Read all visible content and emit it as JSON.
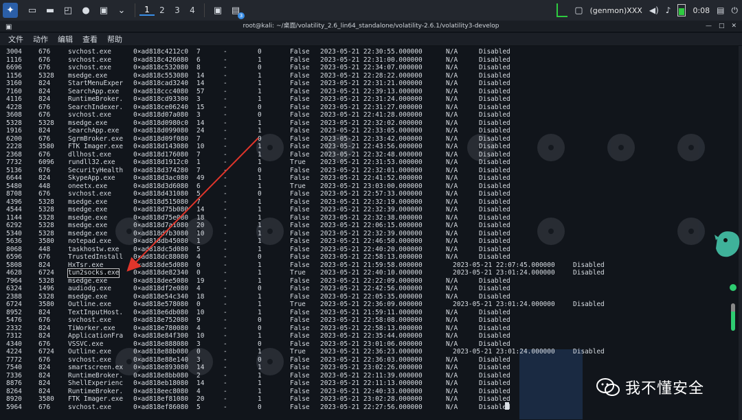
{
  "taskbar": {
    "workspaces": [
      "1",
      "2",
      "3",
      "4"
    ],
    "active_workspace": "1",
    "genmon": "(genmon)XXX",
    "clock": "0:08",
    "badge_count": "3"
  },
  "window": {
    "title": "root@kali: ~/桌面/volatility_2.6_lin64_standalone/volatility-2.6.1/volatility3-develop"
  },
  "menu": [
    "文件",
    "动作",
    "编辑",
    "查看",
    "帮助"
  ],
  "rows": [
    {
      "pid": "3004",
      "ppid": "676",
      "name": "svchost.exe",
      "offset": "0×ad818c4212c0",
      "threads": "7",
      "handles": "-",
      "session": "0",
      "wow64": "False",
      "create": "2023-05-21 22:30:55.000000",
      "exit": "N/A",
      "output": "Disabled"
    },
    {
      "pid": "1116",
      "ppid": "676",
      "name": "svchost.exe",
      "offset": "0×ad818c426080",
      "threads": "6",
      "handles": "-",
      "session": "1",
      "wow64": "False",
      "create": "2023-05-21 22:31:00.000000",
      "exit": "N/A",
      "output": "Disabled"
    },
    {
      "pid": "6696",
      "ppid": "676",
      "name": "svchost.exe",
      "offset": "0×ad818c532080",
      "threads": "8",
      "handles": "-",
      "session": "0",
      "wow64": "False",
      "create": "2023-05-21 22:34:07.000000",
      "exit": "N/A",
      "output": "Disabled"
    },
    {
      "pid": "1156",
      "ppid": "5328",
      "name": "msedge.exe",
      "offset": "0×ad818c553080",
      "threads": "14",
      "handles": "-",
      "session": "1",
      "wow64": "False",
      "create": "2023-05-21 22:28:22.000000",
      "exit": "N/A",
      "output": "Disabled",
      "highlight": true
    },
    {
      "pid": "3160",
      "ppid": "824",
      "name": "StartMenuExper",
      "offset": "0×ad818cad3240",
      "threads": "14",
      "handles": "-",
      "session": "1",
      "wow64": "False",
      "create": "2023-05-21 22:31:21.000000",
      "exit": "N/A",
      "output": "Disabled"
    },
    {
      "pid": "7160",
      "ppid": "824",
      "name": "SearchApp.exe",
      "offset": "0×ad818ccc4080",
      "threads": "57",
      "handles": "-",
      "session": "1",
      "wow64": "False",
      "create": "2023-05-21 22:39:13.000000",
      "exit": "N/A",
      "output": "Disabled"
    },
    {
      "pid": "4116",
      "ppid": "824",
      "name": "RuntimeBroker.",
      "offset": "0×ad818cd93300",
      "threads": "3",
      "handles": "-",
      "session": "1",
      "wow64": "False",
      "create": "2023-05-21 22:31:24.000000",
      "exit": "N/A",
      "output": "Disabled"
    },
    {
      "pid": "4228",
      "ppid": "676",
      "name": "SearchIndexer.",
      "offset": "0×ad818ce06240",
      "threads": "15",
      "handles": "-",
      "session": "0",
      "wow64": "False",
      "create": "2023-05-21 22:31:27.000000",
      "exit": "N/A",
      "output": "Disabled"
    },
    {
      "pid": "3608",
      "ppid": "676",
      "name": "svchost.exe",
      "offset": "0×ad818d07a080",
      "threads": "3",
      "handles": "-",
      "session": "0",
      "wow64": "False",
      "create": "2023-05-21 22:41:28.000000",
      "exit": "N/A",
      "output": "Disabled"
    },
    {
      "pid": "5328",
      "ppid": "5328",
      "name": "msedge.exe",
      "offset": "0×ad818d0980c0",
      "threads": "14",
      "handles": "-",
      "session": "1",
      "wow64": "False",
      "create": "2023-05-21 22:32:02.000000",
      "exit": "N/A",
      "output": "Disabled"
    },
    {
      "pid": "1916",
      "ppid": "824",
      "name": "SearchApp.exe",
      "offset": "0×ad818d099080",
      "threads": "24",
      "handles": "-",
      "session": "1",
      "wow64": "False",
      "create": "2023-05-21 22:33:05.000000",
      "exit": "N/A",
      "output": "Disabled"
    },
    {
      "pid": "6200",
      "ppid": "676",
      "name": "SgrmBroker.exe",
      "offset": "0×ad818d09f080",
      "threads": "7",
      "handles": "-",
      "session": "0",
      "wow64": "False",
      "create": "2023-05-21 22:33:42.000000",
      "exit": "N/A",
      "output": "Disabled"
    },
    {
      "pid": "2228",
      "ppid": "3580",
      "name": "FTK Imager.exe",
      "offset": "0×ad818d143080",
      "threads": "10",
      "handles": "-",
      "session": "1",
      "wow64": "False",
      "create": "2023-05-21 22:43:56.000000",
      "exit": "N/A",
      "output": "Disabled"
    },
    {
      "pid": "2368",
      "ppid": "676",
      "name": "dllhost.exe",
      "offset": "0×ad818d176080",
      "threads": "7",
      "handles": "-",
      "session": "1",
      "wow64": "False",
      "create": "2023-05-21 22:32:48.000000",
      "exit": "N/A",
      "output": "Disabled"
    },
    {
      "pid": "7732",
      "ppid": "6096",
      "name": "rundll32.exe",
      "offset": "0×ad818d1912c0",
      "threads": "1",
      "handles": "-",
      "session": "1",
      "wow64": "True",
      "create": "2023-05-21 22:31:53.000000",
      "exit": "N/A",
      "output": "Disabled"
    },
    {
      "pid": "5136",
      "ppid": "676",
      "name": "SecurityHealth",
      "offset": "0×ad818d374280",
      "threads": "7",
      "handles": "-",
      "session": "0",
      "wow64": "False",
      "create": "2023-05-21 22:32:01.000000",
      "exit": "N/A",
      "output": "Disabled"
    },
    {
      "pid": "6644",
      "ppid": "824",
      "name": "SkypeApp.exe",
      "offset": "0×ad818d3ac080",
      "threads": "49",
      "handles": "-",
      "session": "1",
      "wow64": "False",
      "create": "2023-05-21 22:41:52.000000",
      "exit": "N/A",
      "output": "Disabled"
    },
    {
      "pid": "5480",
      "ppid": "448",
      "name": "oneetx.exe",
      "offset": "0×ad818d3d6080",
      "threads": "6",
      "handles": "-",
      "session": "1",
      "wow64": "True",
      "create": "2023-05-21 23:03:00.000000",
      "exit": "N/A",
      "output": "Disabled"
    },
    {
      "pid": "8708",
      "ppid": "676",
      "name": "svchost.exe",
      "offset": "0×ad818d431080",
      "threads": "5",
      "handles": "-",
      "session": "0",
      "wow64": "False",
      "create": "2023-05-21 22:57:33.000000",
      "exit": "N/A",
      "output": "Disabled"
    },
    {
      "pid": "4396",
      "ppid": "5328",
      "name": "msedge.exe",
      "offset": "0×ad818d515080",
      "threads": "7",
      "handles": "-",
      "session": "1",
      "wow64": "False",
      "create": "2023-05-21 22:32:19.000000",
      "exit": "N/A",
      "output": "Disabled"
    },
    {
      "pid": "4544",
      "ppid": "5328",
      "name": "msedge.exe",
      "offset": "0×ad818d75b080",
      "threads": "14",
      "handles": "-",
      "session": "1",
      "wow64": "False",
      "create": "2023-05-21 22:32:39.000000",
      "exit": "N/A",
      "output": "Disabled"
    },
    {
      "pid": "1144",
      "ppid": "5328",
      "name": "msedge.exe",
      "offset": "0×ad818d75e080",
      "threads": "18",
      "handles": "-",
      "session": "1",
      "wow64": "False",
      "create": "2023-05-21 22:32:38.000000",
      "exit": "N/A",
      "output": "Disabled"
    },
    {
      "pid": "6292",
      "ppid": "5328",
      "name": "msedge.exe",
      "offset": "0×ad818d7a1080",
      "threads": "20",
      "handles": "-",
      "session": "1",
      "wow64": "False",
      "create": "2023-05-21 22:06:15.000000",
      "exit": "N/A",
      "output": "Disabled"
    },
    {
      "pid": "5340",
      "ppid": "5328",
      "name": "msedge.exe",
      "offset": "0×ad818d7b3080",
      "threads": "10",
      "handles": "-",
      "session": "1",
      "wow64": "False",
      "create": "2023-05-21 22:32:39.000000",
      "exit": "N/A",
      "output": "Disabled"
    },
    {
      "pid": "5636",
      "ppid": "3580",
      "name": "notepad.exe",
      "offset": "0×ad818db45080",
      "threads": "1",
      "handles": "-",
      "session": "1",
      "wow64": "False",
      "create": "2023-05-21 22:46:50.000000",
      "exit": "N/A",
      "output": "Disabled"
    },
    {
      "pid": "8068",
      "ppid": "448",
      "name": "taskhostw.exe",
      "offset": "0×ad818dc5d080",
      "threads": "5",
      "handles": "-",
      "session": "1",
      "wow64": "False",
      "create": "2023-05-21 22:40:20.000000",
      "exit": "N/A",
      "output": "Disabled"
    },
    {
      "pid": "6596",
      "ppid": "676",
      "name": "TrustedInstall",
      "offset": "0×ad818dc88080",
      "threads": "4",
      "handles": "-",
      "session": "0",
      "wow64": "False",
      "create": "2023-05-21 22:58:13.000000",
      "exit": "N/A",
      "output": "Disabled"
    },
    {
      "pid": "5808",
      "ppid": "824",
      "name": "HxTsr.exe",
      "offset": "0×ad818de5d080",
      "threads": "0",
      "handles": "-",
      "session": "1",
      "wow64": "False",
      "create": "2023-05-21 21:59:58.000000",
      "exit": "2023-05-21 22:07:45.000000",
      "output": "Disabled"
    },
    {
      "pid": "4628",
      "ppid": "6724",
      "name": "tun2socks.exe",
      "offset": "0×ad818de82340",
      "threads": "0",
      "handles": "-",
      "session": "1",
      "wow64": "True",
      "create": "2023-05-21 22:40:10.000000",
      "exit": "2023-05-21 23:01:24.000000",
      "output": "Disabled",
      "boxed": true
    },
    {
      "pid": "7964",
      "ppid": "5328",
      "name": "msedge.exe",
      "offset": "0×ad818dee5080",
      "threads": "19",
      "handles": "-",
      "session": "1",
      "wow64": "False",
      "create": "2023-05-21 22:22:09.000000",
      "exit": "N/A",
      "output": "Disabled"
    },
    {
      "pid": "6324",
      "ppid": "1496",
      "name": "audiodg.exe",
      "offset": "0×ad818df2e080",
      "threads": "4",
      "handles": "-",
      "session": "0",
      "wow64": "False",
      "create": "2023-05-21 22:42:56.000000",
      "exit": "N/A",
      "output": "Disabled"
    },
    {
      "pid": "2388",
      "ppid": "5328",
      "name": "msedge.exe",
      "offset": "0×ad818e54c340",
      "threads": "18",
      "handles": "-",
      "session": "1",
      "wow64": "False",
      "create": "2023-05-21 22:05:35.000000",
      "exit": "N/A",
      "output": "Disabled"
    },
    {
      "pid": "6724",
      "ppid": "3580",
      "name": "Outline.exe",
      "offset": "0×ad818e578080",
      "threads": "0",
      "handles": "-",
      "session": "1",
      "wow64": "True",
      "create": "2023-05-21 22:36:09.000000",
      "exit": "2023-05-21 23:01:24.000000",
      "output": "Disabled"
    },
    {
      "pid": "8952",
      "ppid": "824",
      "name": "TextInputHost.",
      "offset": "0×ad818e6db080",
      "threads": "10",
      "handles": "-",
      "session": "1",
      "wow64": "False",
      "create": "2023-05-21 21:59:11.000000",
      "exit": "N/A",
      "output": "Disabled"
    },
    {
      "pid": "5476",
      "ppid": "676",
      "name": "svchost.exe",
      "offset": "0×ad818e752080",
      "threads": "9",
      "handles": "-",
      "session": "0",
      "wow64": "False",
      "create": "2023-05-21 22:58:08.000000",
      "exit": "N/A",
      "output": "Disabled"
    },
    {
      "pid": "2332",
      "ppid": "824",
      "name": "TiWorker.exe",
      "offset": "0×ad818e780080",
      "threads": "4",
      "handles": "-",
      "session": "0",
      "wow64": "False",
      "create": "2023-05-21 22:58:13.000000",
      "exit": "N/A",
      "output": "Disabled"
    },
    {
      "pid": "7312",
      "ppid": "824",
      "name": "ApplicationFra",
      "offset": "0×ad818e84f300",
      "threads": "10",
      "handles": "-",
      "session": "1",
      "wow64": "False",
      "create": "2023-05-21 22:35:44.000000",
      "exit": "N/A",
      "output": "Disabled"
    },
    {
      "pid": "4340",
      "ppid": "676",
      "name": "VSSVC.exe",
      "offset": "0×ad818e888080",
      "threads": "3",
      "handles": "-",
      "session": "0",
      "wow64": "False",
      "create": "2023-05-21 23:01:06.000000",
      "exit": "N/A",
      "output": "Disabled"
    },
    {
      "pid": "4224",
      "ppid": "6724",
      "name": "Outline.exe",
      "offset": "0×ad818e88b080",
      "threads": "0",
      "handles": "-",
      "session": "1",
      "wow64": "True",
      "create": "2023-05-21 22:36:23.000000",
      "exit": "2023-05-21 23:01:24.000000",
      "output": "Disabled"
    },
    {
      "pid": "7772",
      "ppid": "676",
      "name": "svchost.exe",
      "offset": "0×ad818e88e140",
      "threads": "3",
      "handles": "-",
      "session": "0",
      "wow64": "False",
      "create": "2023-05-21 22:36:03.000000",
      "exit": "N/A",
      "output": "Disabled"
    },
    {
      "pid": "7540",
      "ppid": "824",
      "name": "smartscreen.ex",
      "offset": "0×ad818e893080",
      "threads": "14",
      "handles": "-",
      "session": "1",
      "wow64": "False",
      "create": "2023-05-21 23:02:26.000000",
      "exit": "N/A",
      "output": "Disabled"
    },
    {
      "pid": "7336",
      "ppid": "824",
      "name": "RuntimeBroker.",
      "offset": "0×ad818e8bb080",
      "threads": "2",
      "handles": "-",
      "session": "1",
      "wow64": "False",
      "create": "2023-05-21 22:11:39.000000",
      "exit": "N/A",
      "output": "Disabled"
    },
    {
      "pid": "8876",
      "ppid": "824",
      "name": "ShellExperienc",
      "offset": "0×ad818eb18080",
      "threads": "14",
      "handles": "-",
      "session": "1",
      "wow64": "False",
      "create": "2023-05-21 22:11:13.000000",
      "exit": "N/A",
      "output": "Disabled"
    },
    {
      "pid": "8264",
      "ppid": "824",
      "name": "RuntimeBroker.",
      "offset": "0×ad818eec8080",
      "threads": "4",
      "handles": "-",
      "session": "1",
      "wow64": "False",
      "create": "2023-05-21 22:40:33.000000",
      "exit": "N/A",
      "output": "Disabled"
    },
    {
      "pid": "8920",
      "ppid": "3580",
      "name": "FTK Imager.exe",
      "offset": "0×ad818ef81080",
      "threads": "20",
      "handles": "-",
      "session": "1",
      "wow64": "False",
      "create": "2023-05-21 23:02:28.000000",
      "exit": "N/A",
      "output": "Disabled"
    },
    {
      "pid": "5964",
      "ppid": "676",
      "name": "svchost.exe",
      "offset": "0×ad818ef86080",
      "threads": "5",
      "handles": "-",
      "session": "0",
      "wow64": "False",
      "create": "2023-05-21 22:27:56.000000",
      "exit": "N/A",
      "output": "Disabled"
    }
  ],
  "watermark": {
    "text": "我不懂安全"
  },
  "colors": {
    "arrow": "#e0352b",
    "highlight": "#b8772e",
    "terminal_bg": "#11151b"
  }
}
